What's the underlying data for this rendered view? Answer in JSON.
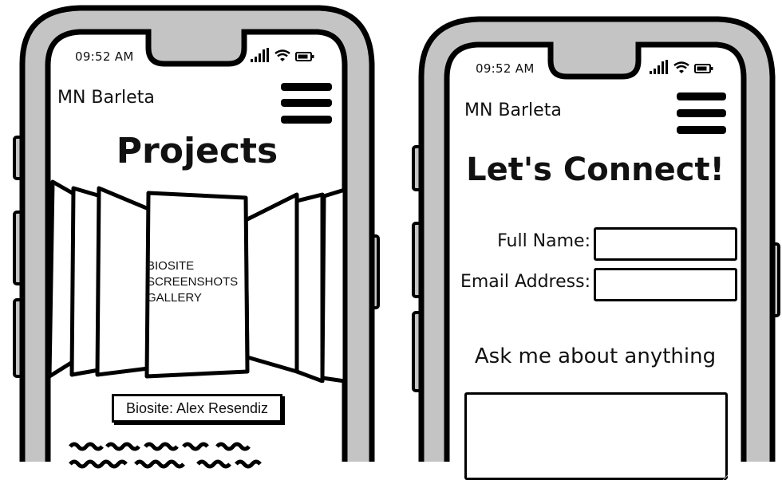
{
  "colors": {
    "device_body": "#c4c4c4",
    "outline": "#000000",
    "screen": "#ffffff"
  },
  "left_phone": {
    "status_time": "09:52 AM",
    "status_icons": [
      "signal-icon",
      "wifi-icon",
      "battery-icon"
    ],
    "brand": "MN Barleta",
    "menu_icon": "hamburger-icon",
    "page_title": "Projects",
    "gallery": {
      "line1": "BIOSITE",
      "line2": "SCREENSHOTS",
      "line3": "GALLERY"
    },
    "caption_button": "Biosite: Alex Resendiz"
  },
  "right_phone": {
    "status_time": "09:52 AM",
    "status_icons": [
      "signal-icon",
      "wifi-icon",
      "battery-icon"
    ],
    "brand": "MN Barleta",
    "menu_icon": "hamburger-icon",
    "page_title": "Let's Connect!",
    "form": {
      "full_name_label": "Full Name:",
      "full_name_value": "",
      "email_label": "Email Address:",
      "email_value": "",
      "message_heading": "Ask me about anything",
      "message_value": ""
    }
  }
}
